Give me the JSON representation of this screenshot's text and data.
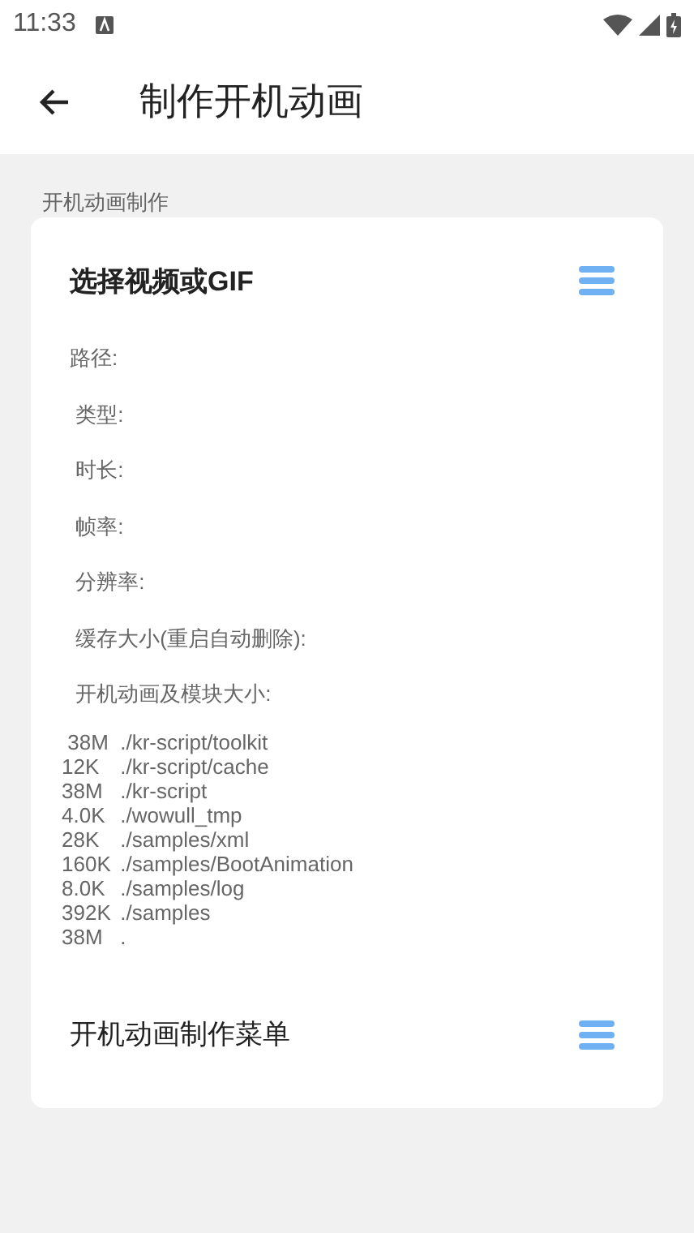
{
  "status_bar": {
    "time": "11:33"
  },
  "app_bar": {
    "title": "制作开机动画"
  },
  "section": {
    "label": "开机动画制作"
  },
  "card": {
    "title": "选择视频或GIF",
    "info": [
      "路径:",
      " 类型:",
      " 时长:",
      " 帧率:",
      " 分辨率:",
      " 缓存大小(重启自动删除):",
      " 开机动画及模块大小:"
    ],
    "sizes": [
      " 38M\t./kr-script/toolkit",
      "12K\t./kr-script/cache",
      "38M\t./kr-script",
      "4.0K\t./wowull_tmp",
      "28K\t./samples/xml",
      "160K\t./samples/BootAnimation",
      "8.0K\t./samples/log",
      "392K\t./samples",
      "38M\t."
    ],
    "menu_title": "开机动画制作菜单"
  }
}
